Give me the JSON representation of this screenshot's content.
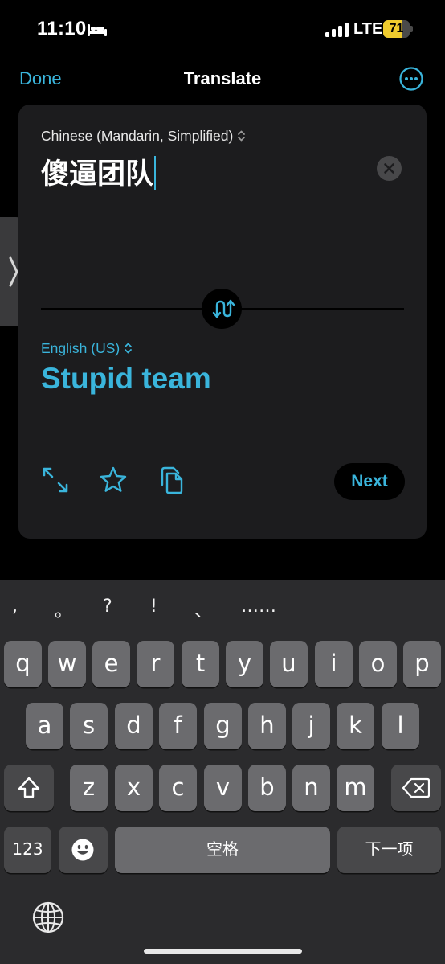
{
  "status_bar": {
    "time": "11:10",
    "network": "LTE",
    "battery_percent": "71",
    "battery_level": 0.71,
    "icons": [
      "bed-icon",
      "signal-icon",
      "battery-icon"
    ]
  },
  "nav": {
    "done_label": "Done",
    "title": "Translate",
    "more_icon": "ellipsis-circle-icon"
  },
  "translator": {
    "source_language": "Chinese (Mandarin, Simplified)",
    "source_text": "傻逼团队",
    "target_language": "English (US)",
    "target_text": "Stupid team",
    "next_label": "Next",
    "icons": [
      "clear-icon",
      "swap-languages-icon",
      "expand-icon",
      "favorite-star-icon",
      "copy-icon",
      "chevron-right-icon"
    ]
  },
  "keyboard": {
    "punctuation": [
      ",",
      "。",
      "?",
      "!",
      "、",
      "……"
    ],
    "row1": [
      "q",
      "w",
      "e",
      "r",
      "t",
      "y",
      "u",
      "i",
      "o",
      "p"
    ],
    "row2": [
      "a",
      "s",
      "d",
      "f",
      "g",
      "h",
      "j",
      "k",
      "l"
    ],
    "row3": [
      "z",
      "x",
      "c",
      "v",
      "b",
      "n",
      "m"
    ],
    "numbers_label": "123",
    "space_label": "空格",
    "next_label": "下一项",
    "icons": [
      "shift-icon",
      "delete-icon",
      "emoji-icon",
      "globe-icon"
    ]
  },
  "colors": {
    "accent": "#3ab5dc",
    "card": "#1c1c1e",
    "keyboard_bg": "#2b2b2d",
    "key": "#6b6b6e",
    "battery": "#f0cc2e"
  }
}
